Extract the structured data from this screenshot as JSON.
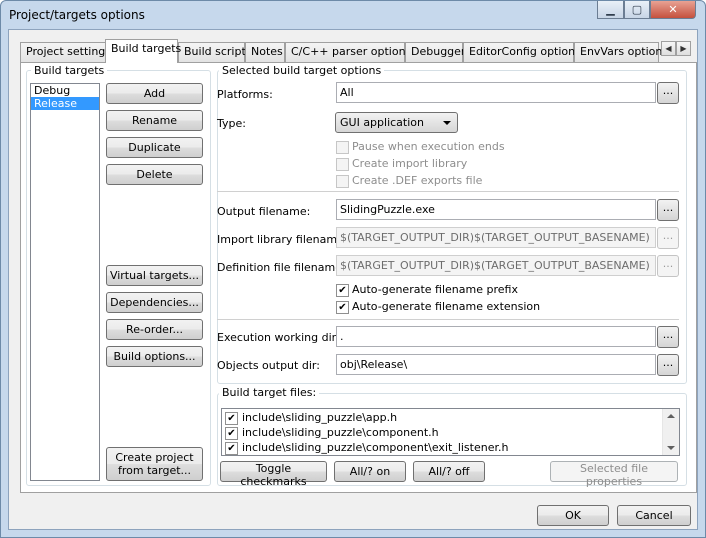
{
  "window": {
    "title": "Project/targets options"
  },
  "tabs": [
    {
      "label": "Project settings",
      "active": false
    },
    {
      "label": "Build targets",
      "active": true
    },
    {
      "label": "Build scripts",
      "active": false
    },
    {
      "label": "Notes",
      "active": false
    },
    {
      "label": "C/C++ parser options",
      "active": false
    },
    {
      "label": "Debugger",
      "active": false
    },
    {
      "label": "EditorConfig options",
      "active": false
    },
    {
      "label": "EnvVars options",
      "active": false
    }
  ],
  "build_targets": {
    "group_label": "Build targets",
    "items": [
      "Debug",
      "Release"
    ],
    "selected": "Release",
    "buttons": {
      "add": "Add",
      "rename": "Rename",
      "duplicate": "Duplicate",
      "delete": "Delete",
      "virtual_targets": "Virtual targets...",
      "dependencies": "Dependencies...",
      "reorder": "Re-order...",
      "build_options": "Build options...",
      "create_project_line1": "Create project",
      "create_project_line2": "from target..."
    }
  },
  "options": {
    "group_label": "Selected build target options",
    "platforms_label": "Platforms:",
    "platforms_value": "All",
    "type_label": "Type:",
    "type_value": "GUI application",
    "pause_label": "Pause when execution ends",
    "create_import_label": "Create import library",
    "create_def_label": "Create .DEF exports file",
    "output_label": "Output filename:",
    "output_value": "SlidingPuzzle.exe",
    "import_label": "Import library filename:",
    "import_value": "$(TARGET_OUTPUT_DIR)$(TARGET_OUTPUT_BASENAME)",
    "def_label": "Definition file filename:",
    "def_value": "$(TARGET_OUTPUT_DIR)$(TARGET_OUTPUT_BASENAME)",
    "auto_prefix_label": "Auto-generate filename prefix",
    "auto_prefix_checked": true,
    "auto_ext_label": "Auto-generate filename extension",
    "auto_ext_checked": true,
    "workdir_label": "Execution working dir:",
    "workdir_value": ".",
    "objdir_label": "Objects output dir:",
    "objdir_value": "obj\\Release\\",
    "browse_label": "..."
  },
  "files": {
    "group_label": "Build target files:",
    "items": [
      {
        "path": "include\\sliding_puzzle\\app.h",
        "checked": true
      },
      {
        "path": "include\\sliding_puzzle\\component.h",
        "checked": true
      },
      {
        "path": "include\\sliding_puzzle\\component\\exit_listener.h",
        "checked": true
      }
    ],
    "buttons": {
      "toggle": "Toggle checkmarks",
      "all_on": "All/? on",
      "all_off": "All/? off",
      "properties": "Selected file properties"
    }
  },
  "dialog": {
    "ok": "OK",
    "cancel": "Cancel"
  },
  "icons": {
    "check": "✔"
  },
  "colors": {
    "selection": "#3399ff",
    "frame": "#c6d8ec",
    "close": "#c5513e"
  }
}
